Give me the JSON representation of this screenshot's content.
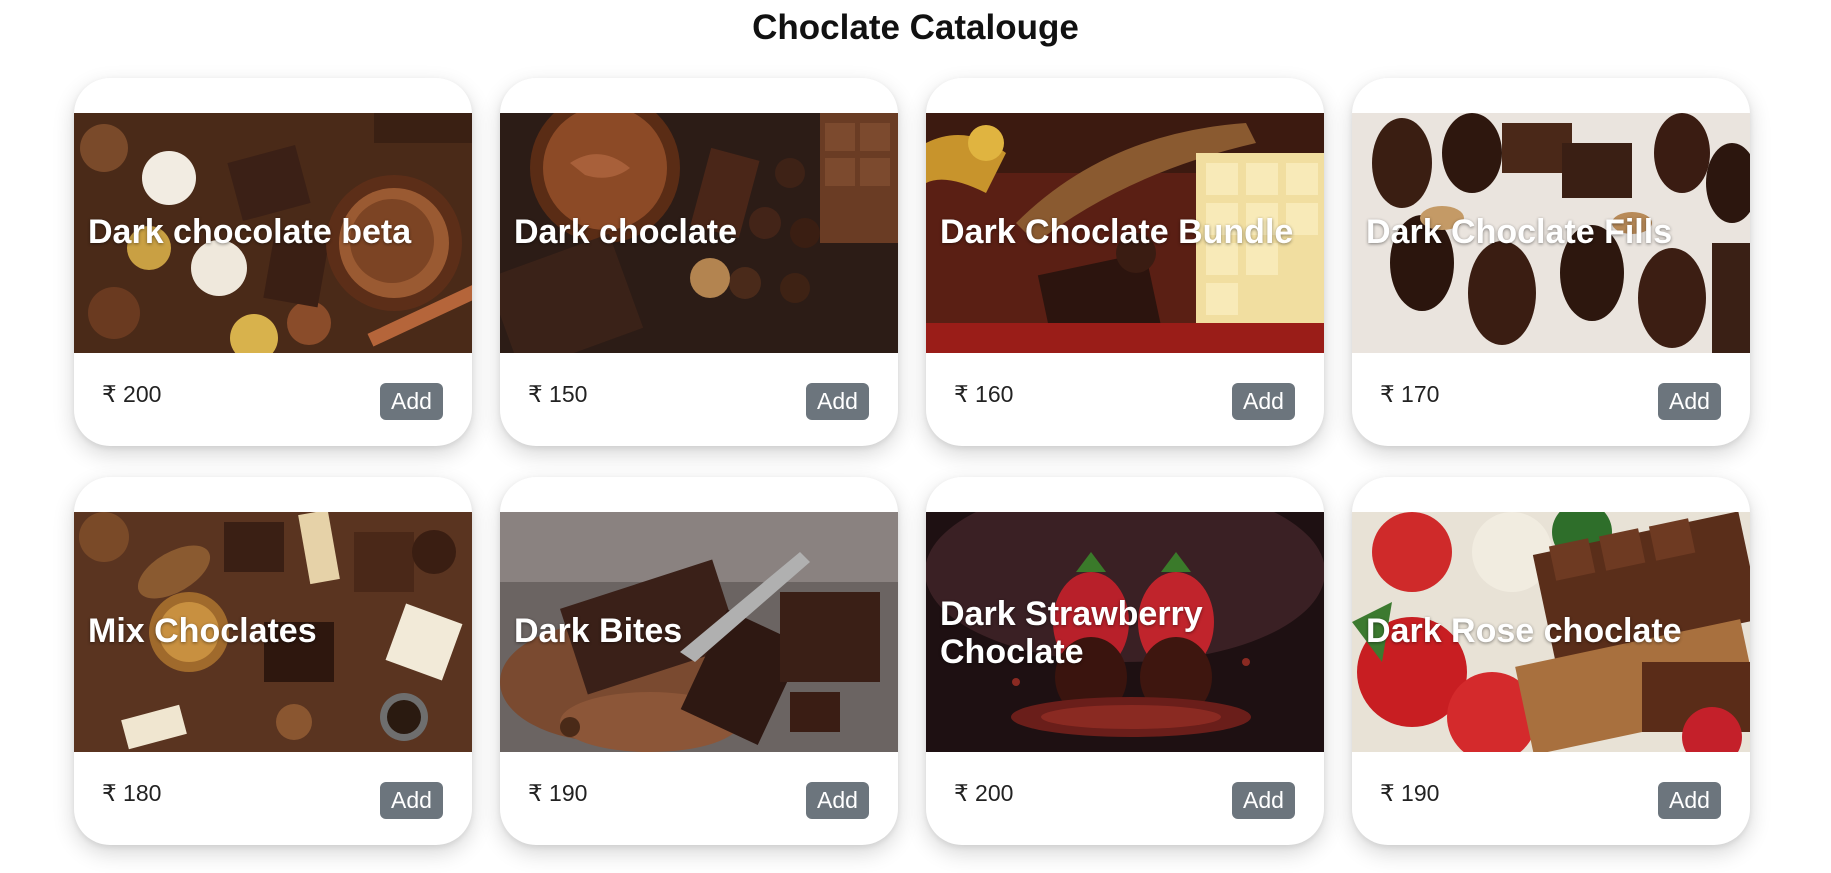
{
  "page": {
    "title": "Choclate Catalouge"
  },
  "colors": {
    "button_bg": "#6c757d",
    "button_text": "#ffffff",
    "card_bg": "#ffffff",
    "title_text": "#ffffff"
  },
  "products": [
    {
      "name": "Dark chocolate beta",
      "price": "₹ 200",
      "button_label": "Add",
      "image": "assorted-truffles-and-chocolate-spread"
    },
    {
      "name": "Dark choclate",
      "price": "₹ 150",
      "button_label": "Add",
      "image": "chocolate-spread-bowl-and-bars"
    },
    {
      "name": "Dark Choclate Bundle",
      "price": "₹ 160",
      "button_label": "Add",
      "image": "gift-box-chocolate-bundle"
    },
    {
      "name": "Dark Choclate Fills",
      "price": "₹ 170",
      "button_label": "Add",
      "image": "filled-dark-pralines"
    },
    {
      "name": "Mix Choclates",
      "price": "₹ 180",
      "button_label": "Add",
      "image": "mixed-chocolates-assortment"
    },
    {
      "name": "Dark Bites",
      "price": "₹ 190",
      "button_label": "Add",
      "image": "chocolate-pieces-with-spoon"
    },
    {
      "name": "Dark Strawberry Choclate",
      "price": "₹ 200",
      "button_label": "Add",
      "image": "chocolate-dipped-strawberries"
    },
    {
      "name": "Dark Rose choclate",
      "price": "₹ 190",
      "button_label": "Add",
      "image": "roses-and-chocolate-bar"
    }
  ]
}
